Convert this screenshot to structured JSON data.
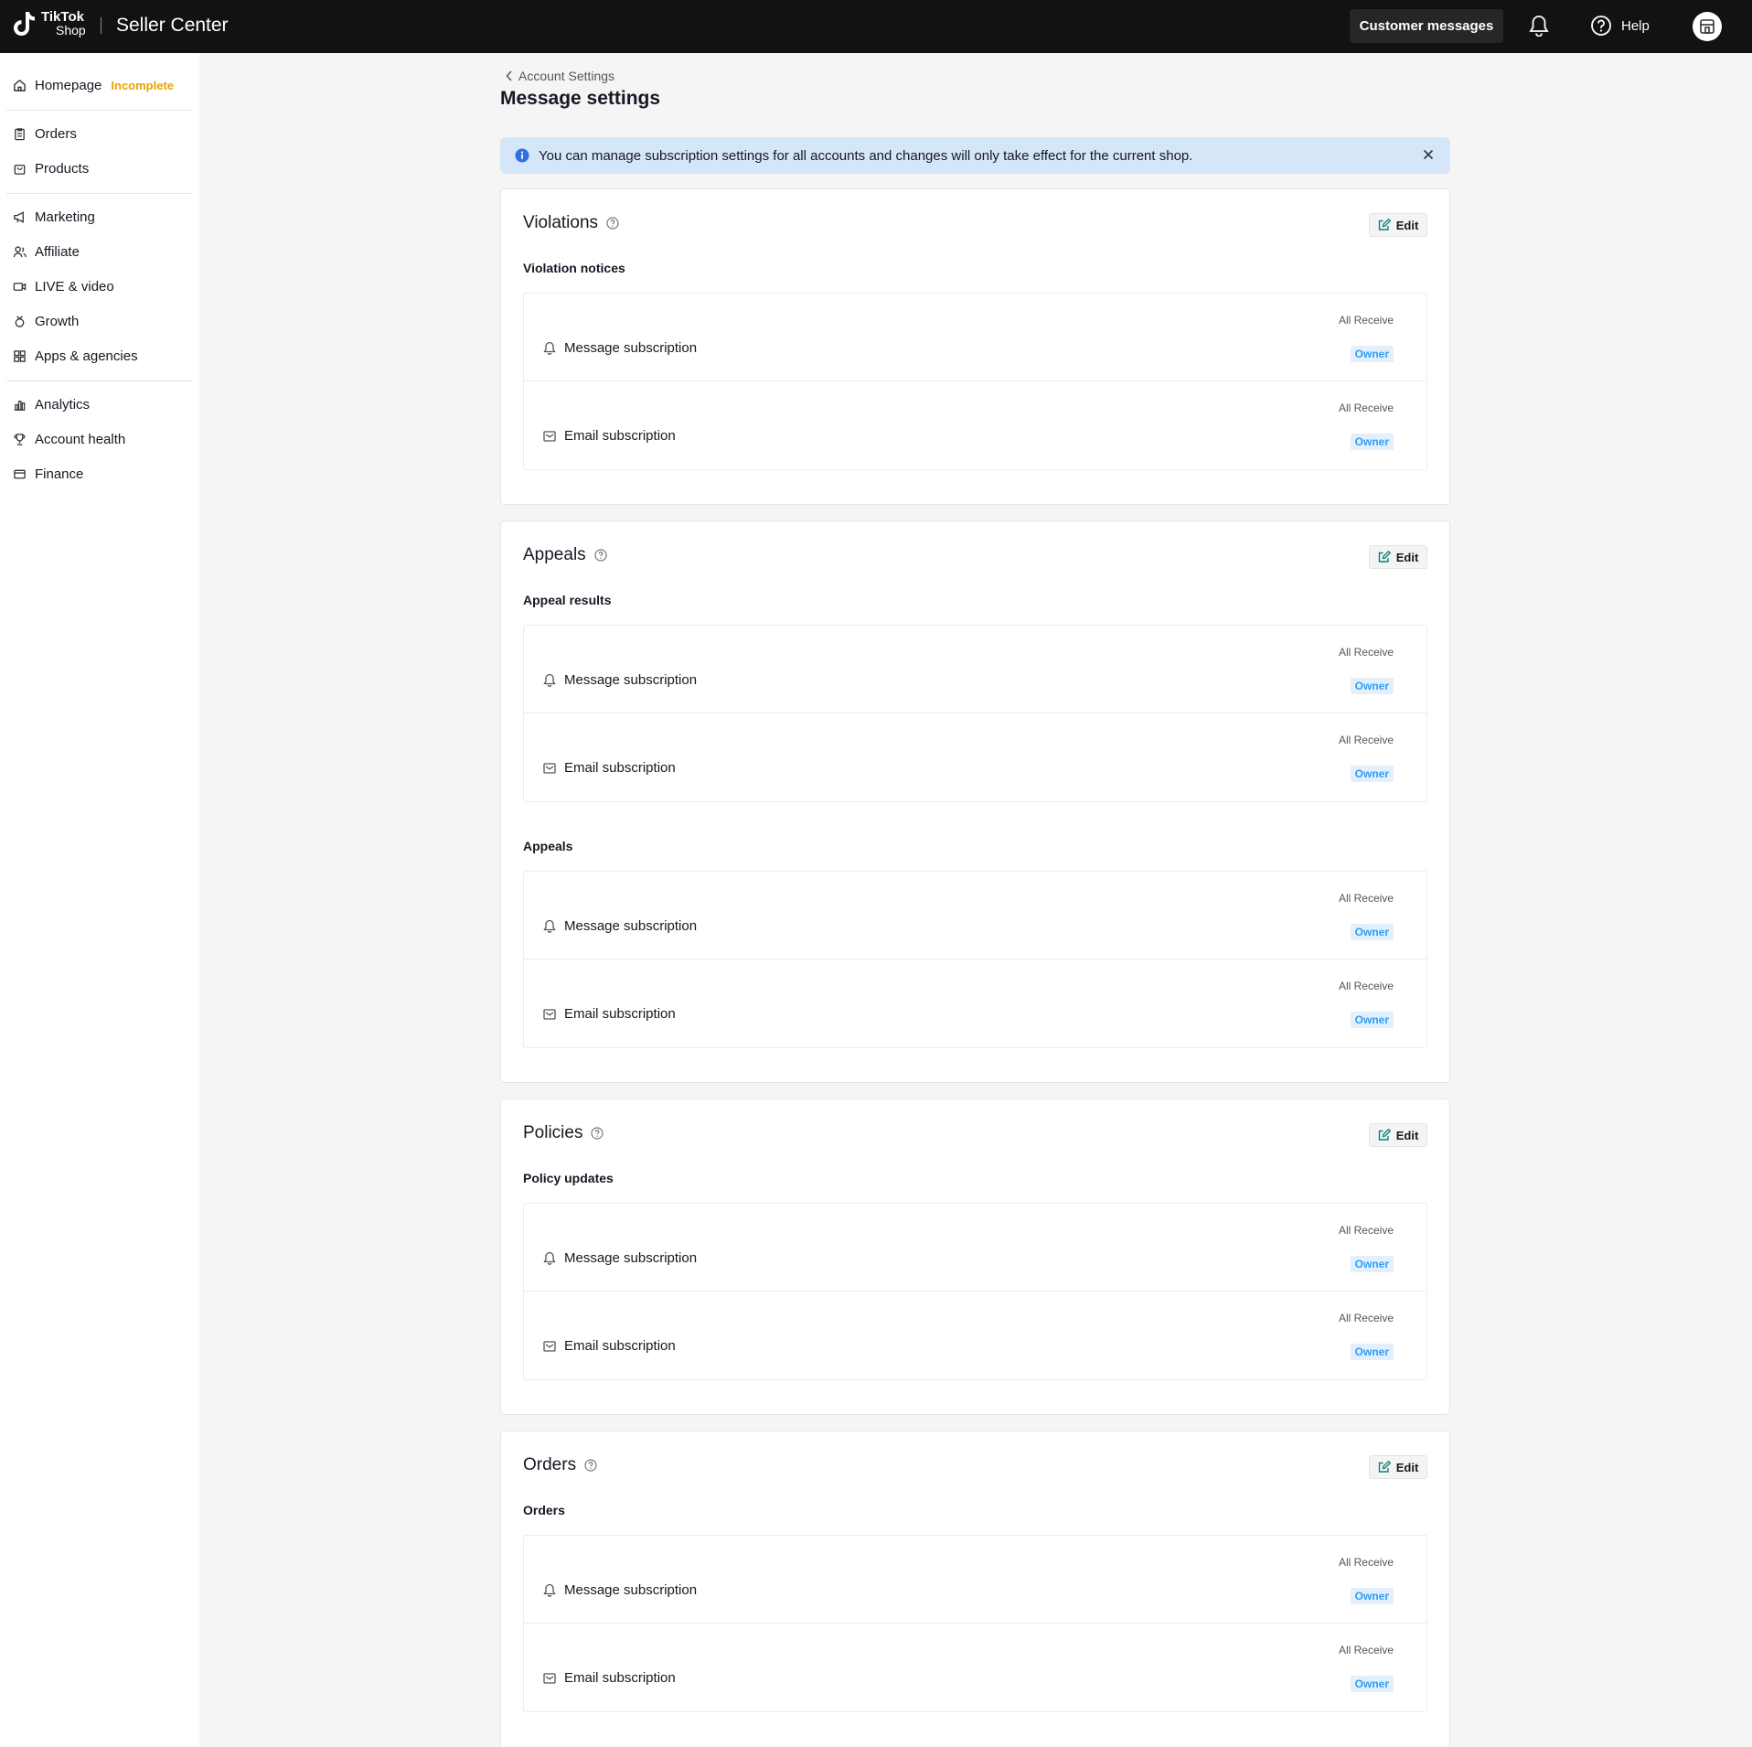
{
  "topbar": {
    "logo_line1": "TikTok",
    "logo_line2": "Shop",
    "product_title": "Seller Center",
    "customer_messages": "Customer messages",
    "help_label": "Help"
  },
  "sidebar": {
    "homepage": "Homepage",
    "homepage_badge": "Incomplete",
    "items": [
      "Orders",
      "Products",
      "Marketing",
      "Affiliate",
      "LIVE & video",
      "Growth",
      "Apps & agencies",
      "Analytics",
      "Account health",
      "Finance"
    ]
  },
  "page": {
    "breadcrumb": "Account Settings",
    "title": "Message settings",
    "banner": "You can manage subscription settings for all accounts and changes will only take effect for the current shop."
  },
  "common": {
    "edit": "Edit",
    "all_receive": "All Receive",
    "owner": "Owner",
    "message_subscription": "Message subscription",
    "email_subscription": "Email subscription"
  },
  "sections": [
    {
      "title": "Violations",
      "groups": [
        "Violation notices"
      ]
    },
    {
      "title": "Appeals",
      "groups": [
        "Appeal results",
        "Appeals"
      ]
    },
    {
      "title": "Policies",
      "groups": [
        "Policy updates"
      ]
    },
    {
      "title": "Orders",
      "groups": [
        "Orders"
      ]
    }
  ]
}
